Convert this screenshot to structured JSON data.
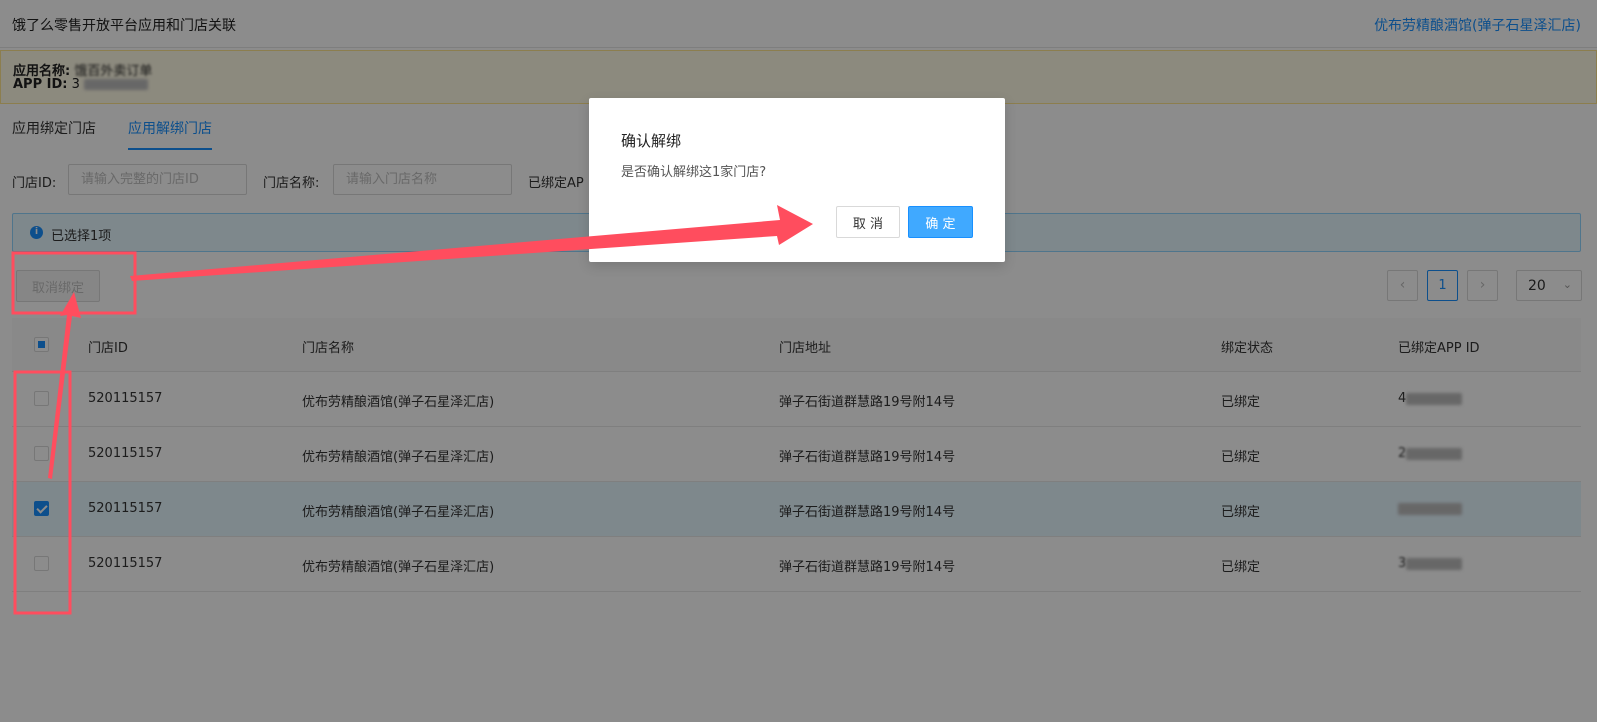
{
  "header": {
    "title": "饿了么零售开放平台应用和门店关联",
    "current_store": "优布劳精酿酒馆(弹子石星泽汇店)"
  },
  "app_info": {
    "name_label": "应用名称:",
    "name_value": "饿百外卖订单",
    "id_label": "APP ID:",
    "id_value": "3"
  },
  "tabs": [
    {
      "label": "应用绑定门店"
    },
    {
      "label": "应用解绑门店"
    }
  ],
  "filters": {
    "store_id_label": "门店ID:",
    "store_id_placeholder": "请输入完整的门店ID",
    "store_name_label": "门店名称:",
    "store_name_placeholder": "请输入门店名称",
    "bound_app_label": "已绑定AP"
  },
  "selection": {
    "info_icon": "i",
    "text": "已选择1项"
  },
  "actions": {
    "unbind_label": "取消绑定"
  },
  "pagination": {
    "prev": "‹",
    "current_page": "1",
    "next": "›",
    "page_size": "20",
    "chevron": "⌄"
  },
  "table": {
    "columns": [
      "门店ID",
      "门店名称",
      "门店地址",
      "绑定状态",
      "已绑定APP ID"
    ],
    "rows": [
      {
        "id": "520115157",
        "name": "优布劳精酿酒馆(弹子石星泽汇店)",
        "address": "弹子石街道群慧路19号附14号",
        "status": "已绑定",
        "app_id": "4",
        "checked": false
      },
      {
        "id": "520115157",
        "name": "优布劳精酿酒馆(弹子石星泽汇店)",
        "address": "弹子石街道群慧路19号附14号",
        "status": "已绑定",
        "app_id": "2",
        "checked": false
      },
      {
        "id": "520115157",
        "name": "优布劳精酿酒馆(弹子石星泽汇店)",
        "address": "弹子石街道群慧路19号附14号",
        "status": "已绑定",
        "app_id": "",
        "checked": true
      },
      {
        "id": "520115157",
        "name": "优布劳精酿酒馆(弹子石星泽汇店)",
        "address": "弹子石街道群慧路19号附14号",
        "status": "已绑定",
        "app_id": "3",
        "checked": false
      }
    ]
  },
  "modal": {
    "title": "确认解绑",
    "content": "是否确认解绑这1家门店?",
    "cancel_label": "取 消",
    "ok_label": "确 定"
  },
  "colors": {
    "accent": "#1890ff",
    "annotation": "#ff4d5e",
    "warning_bg": "#fffbe6"
  }
}
